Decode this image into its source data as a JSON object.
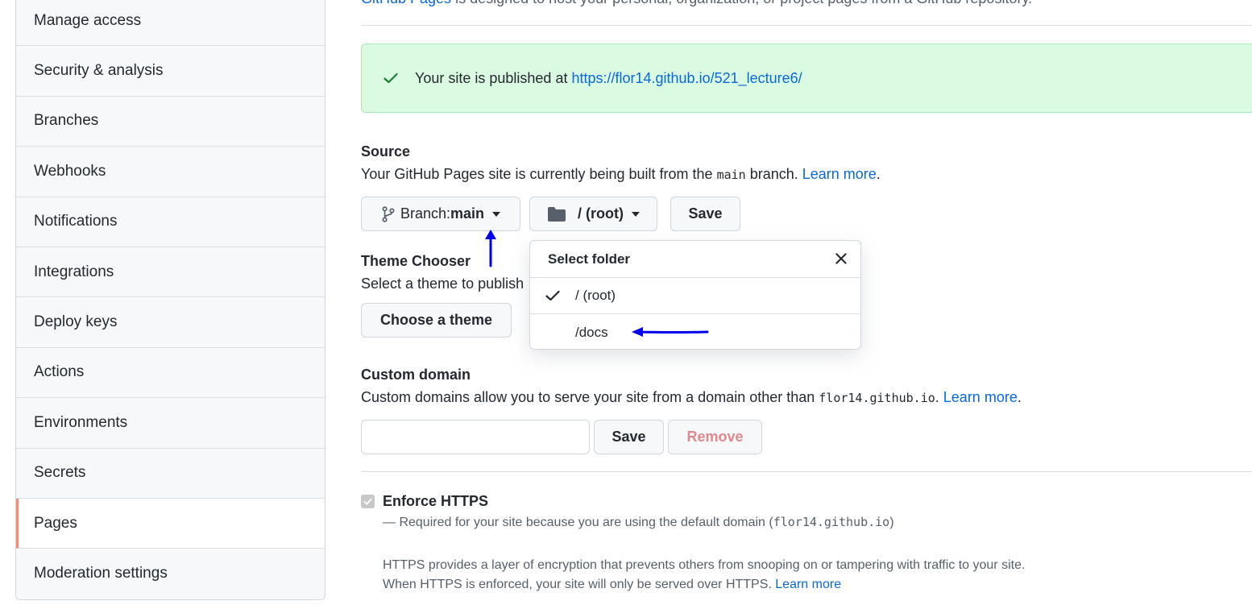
{
  "sidebar": {
    "items": [
      {
        "label": "Manage access",
        "active": false
      },
      {
        "label": "Security & analysis",
        "active": false
      },
      {
        "label": "Branches",
        "active": false
      },
      {
        "label": "Webhooks",
        "active": false
      },
      {
        "label": "Notifications",
        "active": false
      },
      {
        "label": "Integrations",
        "active": false
      },
      {
        "label": "Deploy keys",
        "active": false
      },
      {
        "label": "Actions",
        "active": false
      },
      {
        "label": "Environments",
        "active": false
      },
      {
        "label": "Secrets",
        "active": false
      },
      {
        "label": "Pages",
        "active": true
      },
      {
        "label": "Moderation settings",
        "active": false
      }
    ]
  },
  "intro": {
    "link": "GitHub Pages",
    "text": " is designed to host your personal, organization, or project pages from a GitHub repository."
  },
  "flash": {
    "text": "Your site is published at ",
    "url": "https://flor14.github.io/521_lecture6/"
  },
  "source": {
    "heading": "Source",
    "desc_before": "Your GitHub Pages site is currently being built from the ",
    "branch_code": "main",
    "desc_after": " branch. ",
    "learn_more": "Learn more",
    "period": ".",
    "branch_prefix": "Branch: ",
    "branch_value": "main",
    "folder_label": "/ (root)",
    "save_label": "Save"
  },
  "folder_dropdown": {
    "title": "Select folder",
    "options": [
      {
        "label": "/ (root)",
        "selected": true
      },
      {
        "label": "/docs",
        "selected": false
      }
    ]
  },
  "theme": {
    "heading": "Theme Chooser",
    "desc": "Select a theme to publish",
    "button": "Choose a theme"
  },
  "custom_domain": {
    "heading": "Custom domain",
    "desc_before": "Custom domains allow you to serve your site from a domain other than ",
    "domain_code": "flor14.github.io",
    "desc_after": ". ",
    "learn_more": "Learn more",
    "period": ".",
    "input_value": "",
    "save_label": "Save",
    "remove_label": "Remove"
  },
  "https": {
    "label": "Enforce HTTPS",
    "required_before": "— Required for your site because you are using the default domain (",
    "required_code": "flor14.github.io",
    "required_after": ")",
    "info_line1": "HTTPS provides a layer of encryption that prevents others from snooping on or tampering with traffic to your site.",
    "info_line2": "When HTTPS is enforced, your site will only be served over HTTPS. ",
    "learn_more": "Learn more",
    "checked": true,
    "disabled": true
  },
  "colors": {
    "accent": "#0969da",
    "success_bg": "#dafbe1",
    "success_icon": "#1a7f37",
    "active_marker": "#fd8c73",
    "annotation_arrow": "#0000ee"
  }
}
